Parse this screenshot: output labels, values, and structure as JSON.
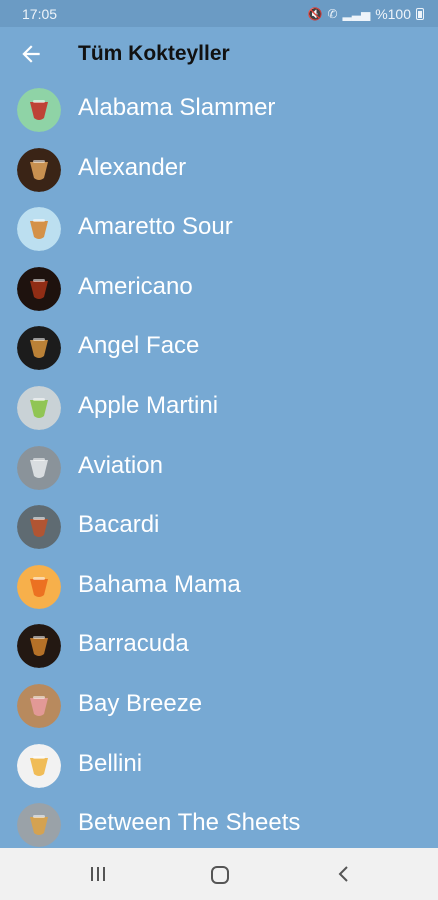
{
  "status": {
    "time": "17:05",
    "battery": "%100"
  },
  "header": {
    "title": "Tüm Kokteyller"
  },
  "colors": {
    "background": "#77a9d3",
    "status_bar": "#6b9bc4",
    "nav_bar": "#f1f1f1",
    "text": "#ffffff"
  },
  "cocktails": [
    {
      "name": "Alabama Slammer",
      "thumb": [
        "#8fd3a6",
        "#c2362c"
      ]
    },
    {
      "name": "Alexander",
      "thumb": [
        "#3a2416",
        "#d59a56"
      ]
    },
    {
      "name": "Amaretto Sour",
      "thumb": [
        "#bcdff0",
        "#d68a3a"
      ]
    },
    {
      "name": "Americano",
      "thumb": [
        "#1e120e",
        "#9a3016"
      ]
    },
    {
      "name": "Angel Face",
      "thumb": [
        "#1c1c1c",
        "#c88a3a"
      ]
    },
    {
      "name": "Apple Martini",
      "thumb": [
        "#c9d2d6",
        "#8bc34a"
      ]
    },
    {
      "name": "Aviation",
      "thumb": [
        "#8a939a",
        "#dfe3e6"
      ]
    },
    {
      "name": "Bacardi",
      "thumb": [
        "#5f6b72",
        "#b9542e"
      ]
    },
    {
      "name": "Bahama Mama",
      "thumb": [
        "#f7b04b",
        "#ea6b1d"
      ]
    },
    {
      "name": "Barracuda",
      "thumb": [
        "#231812",
        "#c27a2a"
      ]
    },
    {
      "name": "Bay Breeze",
      "thumb": [
        "#b88a5e",
        "#e59a9b"
      ]
    },
    {
      "name": "Bellini",
      "thumb": [
        "#f2f2f2",
        "#f0b74a"
      ]
    },
    {
      "name": "Between The Sheets",
      "thumb": [
        "#9aa2a8",
        "#d9a24a"
      ]
    }
  ]
}
